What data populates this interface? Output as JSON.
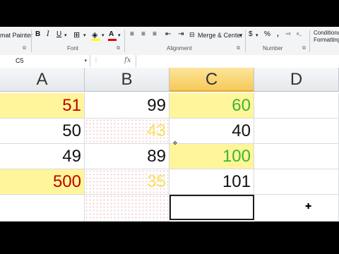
{
  "ribbon": {
    "clipboard_label": "mat Painter",
    "font_group": "Font",
    "alignment_group": "Alignment",
    "number_group": "Number",
    "merge_center": "Merge & Center",
    "currency": "$",
    "percent": "%",
    "comma": ",",
    "conditional_line1": "Conditional",
    "conditional_line2": "Formatting",
    "bold": "B",
    "italic": "I",
    "underline": "U"
  },
  "formula_bar": {
    "name_box": "C5",
    "fx": "fx",
    "value": ""
  },
  "columns": [
    "A",
    "B",
    "C",
    "D"
  ],
  "selected_column": "C",
  "selected_cell": "C5",
  "colors": {
    "yellow_fill": "#fff59a",
    "red_text": "#c00000",
    "green_text": "#3cb531",
    "yellow_text": "#f7e15a",
    "black_text": "#111111"
  },
  "rows": [
    {
      "A": "51",
      "B": "99",
      "C": "60",
      "D": ""
    },
    {
      "A": "50",
      "B": "43",
      "C": "40",
      "D": ""
    },
    {
      "A": "49",
      "B": "89",
      "C": "100",
      "D": ""
    },
    {
      "A": "500",
      "B": "35",
      "C": "101",
      "D": ""
    },
    {
      "A": "",
      "B": "",
      "C": "",
      "D": ""
    }
  ]
}
